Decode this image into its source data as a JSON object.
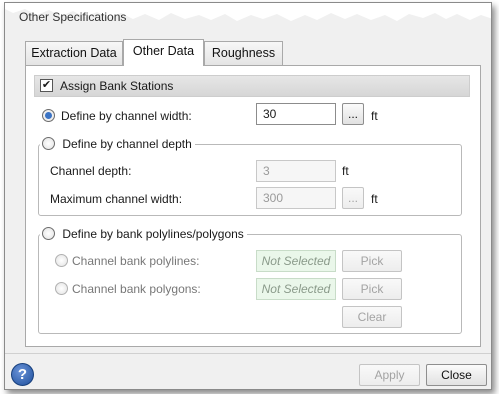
{
  "window": {
    "title": "Other Specifications"
  },
  "tabs": [
    {
      "label": "Extraction Data",
      "active": false
    },
    {
      "label": "Other Data",
      "active": true
    },
    {
      "label": "Roughness",
      "active": false
    }
  ],
  "assign": {
    "label": "Assign Bank Stations",
    "checked": true
  },
  "width_option": {
    "label": "Define by channel width:",
    "selected": true,
    "value": "30",
    "browse_label": "...",
    "unit": "ft"
  },
  "depth_option": {
    "label": "Define by channel depth",
    "selected": false,
    "channel_depth_label": "Channel depth:",
    "channel_depth_value": "3",
    "channel_depth_unit": "ft",
    "max_width_label": "Maximum channel width:",
    "max_width_value": "300",
    "browse_label": "...",
    "max_width_unit": "ft"
  },
  "polyline_option": {
    "label": "Define by bank polylines/polygons",
    "selected": false,
    "polylines_label": "Channel bank polylines:",
    "polylines_value": "Not Selected",
    "polylines_pick": "Pick",
    "polygons_label": "Channel bank polygons:",
    "polygons_value": "Not Selected",
    "polygons_pick": "Pick",
    "clear_label": "Clear"
  },
  "footer": {
    "help_icon": "?",
    "apply_label": "Apply",
    "close_label": "Close"
  },
  "colors": {
    "accent": "#3b73c4",
    "help": "#1e4f9c"
  }
}
